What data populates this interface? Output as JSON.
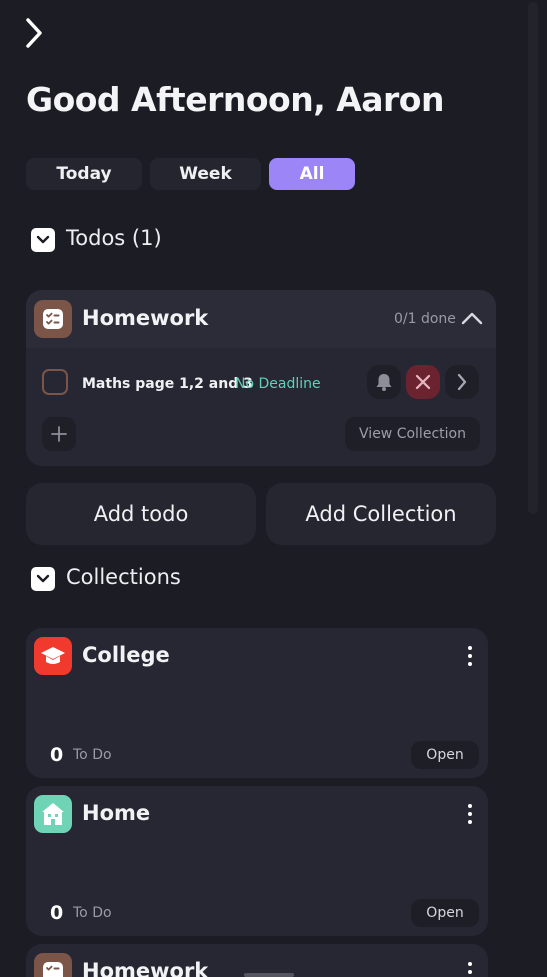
{
  "header": {
    "greeting": "Good Afternoon, Aaron"
  },
  "filters": {
    "tabs": [
      "Today",
      "Week",
      "All"
    ],
    "active": "All"
  },
  "todos_section": {
    "title": "Todos (1)"
  },
  "todo_group": {
    "name": "Homework",
    "progress": "0/1 done",
    "item": {
      "text": "Maths page 1,2 and 3",
      "deadline": "No Deadline"
    },
    "view_label": "View Collection"
  },
  "actions": {
    "add_todo": "Add todo",
    "add_collection": "Add Collection"
  },
  "collections_section": {
    "title": "Collections"
  },
  "collections": [
    {
      "name": "College",
      "count": "0",
      "todo_label": "To Do",
      "open": "Open",
      "icon": "graduation-cap-icon",
      "color": "#f03a2e"
    },
    {
      "name": "Home",
      "count": "0",
      "todo_label": "To Do",
      "open": "Open",
      "icon": "house-icon",
      "color": "#6fd3b6"
    },
    {
      "name": "Homework",
      "icon": "checklist-icon",
      "color": "#7a5548"
    }
  ],
  "colors": {
    "accent": "#9c86f7",
    "deadline": "#5fd2b5",
    "delete": "#6b2330",
    "surface": "#272733"
  }
}
